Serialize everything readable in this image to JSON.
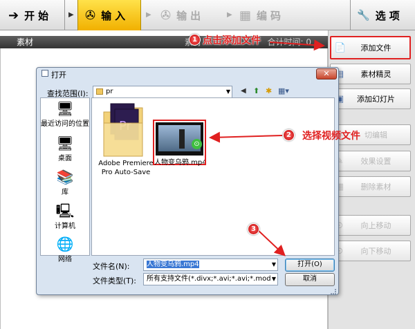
{
  "topbar": {
    "tabs": [
      {
        "label": "开始",
        "icon": "arrow-right-icon",
        "state": "normal"
      },
      {
        "label": "输入",
        "icon": "film-reel-icon",
        "state": "active"
      },
      {
        "label": "输出",
        "icon": "film-reel-icon",
        "state": "disabled"
      },
      {
        "label": "编码",
        "icon": "film-strip-icon",
        "state": "disabled"
      },
      {
        "label": "选项",
        "icon": "wrench-icon",
        "state": "normal"
      }
    ],
    "glyphs": {
      "start": "➔",
      "input": "✇",
      "output": "✇",
      "encode": "▦",
      "options": "🔧",
      "play": "▶"
    }
  },
  "section": {
    "title": "素材",
    "right_text_a": "素材",
    "right_text_b": "合计时间: 0"
  },
  "right_panel": {
    "buttons": [
      {
        "label": "添加文件",
        "icon": "add-file-icon",
        "glyph": "📄",
        "enabled": true
      },
      {
        "label": "素材精灵",
        "icon": "wizard-icon",
        "glyph": "▤",
        "enabled": true
      },
      {
        "label": "添加幻灯片",
        "icon": "slideshow-icon",
        "glyph": "▣",
        "enabled": true
      },
      {
        "label": "切编辑",
        "icon": "scissors-icon",
        "glyph": "✂",
        "enabled": false
      },
      {
        "label": "效果设置",
        "icon": "effects-icon",
        "glyph": "✎",
        "enabled": false
      },
      {
        "label": "删除素材",
        "icon": "delete-icon",
        "glyph": "▦",
        "enabled": false
      },
      {
        "label": "向上移动",
        "icon": "move-up-icon",
        "glyph": "⊙",
        "enabled": false
      },
      {
        "label": "向下移动",
        "icon": "move-down-icon",
        "glyph": "⊙",
        "enabled": false
      }
    ]
  },
  "dialog": {
    "title": "打开",
    "close_glyph": "✕",
    "look_in_label": "查找范围(I):",
    "look_in_value": "pr",
    "toolbar_glyphs": {
      "back": "◀",
      "up": "⬆",
      "new_folder": "✱",
      "view": "▦▾"
    },
    "nav_items": [
      {
        "label": "最近访问的位置",
        "icon": "recent-places-icon",
        "glyph": "🖥"
      },
      {
        "label": "桌面",
        "icon": "desktop-icon",
        "glyph": "🖥"
      },
      {
        "label": "库",
        "icon": "libraries-icon",
        "glyph": "📚"
      },
      {
        "label": "计算机",
        "icon": "computer-icon",
        "glyph": "🖳"
      },
      {
        "label": "网络",
        "icon": "network-icon",
        "glyph": "🌐"
      }
    ],
    "files": [
      {
        "name_line1": "Adobe Premiere",
        "name_line2": "Pro Auto-Save",
        "type": "folder"
      },
      {
        "name": "人物变乌鸦.mp4",
        "type": "video",
        "badge_glyph": "⊙"
      }
    ],
    "filename_label": "文件名(N):",
    "filename_value": "人物变乌鸦.mp4",
    "filetype_label": "文件类型(T):",
    "filetype_value": "所有支持文件(*.divx;*.avi;*.avi;*.mod",
    "open_button": "打开(O)",
    "cancel_button": "取消"
  },
  "annotations": [
    {
      "number": "1",
      "text": "点击添加文件"
    },
    {
      "number": "2",
      "text": "选择视频文件"
    },
    {
      "number": "3",
      "text": ""
    }
  ],
  "colors": {
    "accent_yellow": "#f5c400",
    "annotation_red": "#e02020",
    "dialog_bg": "#d9e4f1"
  }
}
